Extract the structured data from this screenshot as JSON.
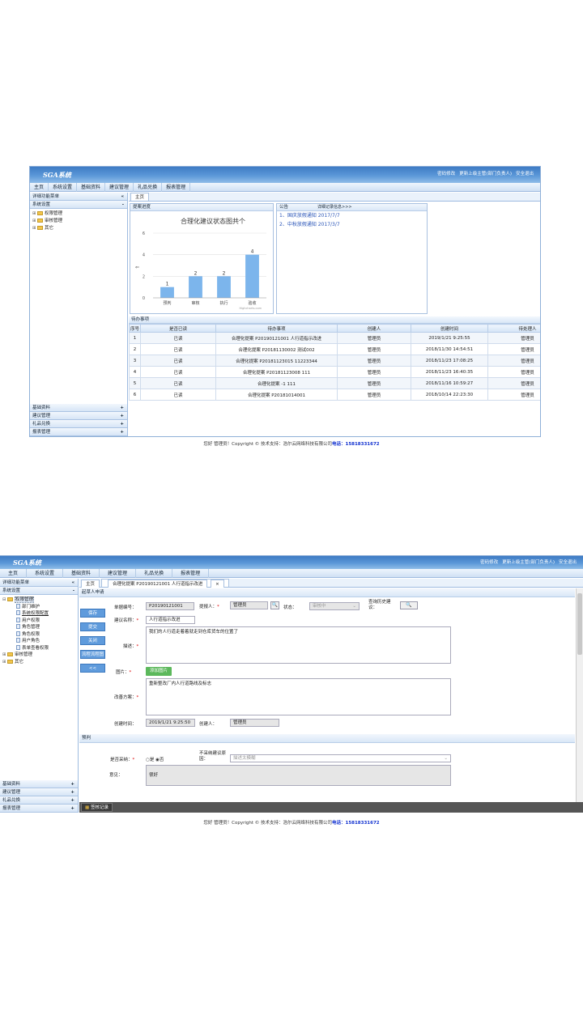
{
  "app": {
    "logo": "SGA系统",
    "top_links": [
      "密码修改",
      "更新上级主管(部门负责人)",
      "安全退出"
    ]
  },
  "menu": [
    "主页",
    "系统设置",
    "基础资料",
    "建议管理",
    "礼品兑换",
    "报表管理"
  ],
  "s1": {
    "sidebar_title": "详细功能菜单",
    "collapse": "«",
    "group": "系统设置",
    "group_toggle": "-",
    "tree": [
      "权限管理",
      "审核管理",
      "其它"
    ],
    "bottom": [
      {
        "label": "基础资料",
        "t": "+"
      },
      {
        "label": "建议管理",
        "t": "+"
      },
      {
        "label": "礼品兑换",
        "t": "+"
      },
      {
        "label": "报表管理",
        "t": "+"
      }
    ],
    "tab": "主页",
    "progress_header": "提案进度",
    "notice_header": "公告",
    "notice_more": "详细记录信息>>>",
    "notices": [
      {
        "n": "1、",
        "t": "国庆放假通知 2017/7/7"
      },
      {
        "n": "2、",
        "t": "中秋放假通知 2017/3/7"
      }
    ],
    "todo_header": "待办事项",
    "todo_cols": [
      "序号",
      "是否已读",
      "待办事项",
      "创建人",
      "创建时间",
      "待处理人"
    ],
    "todo_rows": [
      [
        "1",
        "已读",
        "合理化提案 P20190121001 人行道指示改进",
        "管理员",
        "2019/1/21 9:25:55",
        "管理员"
      ],
      [
        "2",
        "已读",
        "合理化提案 P20181130002 测试002",
        "管理员",
        "2018/11/30 14:54:51",
        "管理员"
      ],
      [
        "3",
        "已读",
        "合理化提案 P20181123015 11223344",
        "管理员",
        "2018/11/23 17:08:25",
        "管理员"
      ],
      [
        "4",
        "已读",
        "合理化提案 P20181123008 111",
        "管理员",
        "2018/11/23 16:40:35",
        "管理员"
      ],
      [
        "5",
        "已读",
        "合理化提案 -1 111",
        "管理员",
        "2018/11/16 10:59:27",
        "管理员"
      ],
      [
        "6",
        "已读",
        "合理化提案 P20181014001",
        "管理员",
        "2018/10/14 22:23:30",
        "管理员"
      ]
    ],
    "footer": "您好 管理员！Copyright © 技术支持：浩尔云网络科技有限公司",
    "footer_phone": "电话：15818331672"
  },
  "chart_data": {
    "type": "bar",
    "title": "合理化建议状态图共个",
    "categories": [
      "预判",
      "审核",
      "执行",
      "验收"
    ],
    "values": [
      1,
      2,
      2,
      4
    ],
    "ylim": [
      0,
      6
    ],
    "yticks": [
      0,
      2,
      4,
      6
    ],
    "color": "#7cb5ec",
    "credit": "Highcharts.com"
  },
  "s2": {
    "sidebar_title": "详细功能菜单",
    "collapse": "«",
    "group": "系统设置",
    "group_toggle": "-",
    "tree": [
      {
        "label": "权限管理",
        "lvl": 0,
        "type": "fold",
        "pm": "⊟",
        "sel": true
      },
      {
        "label": "部门维护",
        "lvl": 1,
        "type": "leaf"
      },
      {
        "label": "系统权限配置",
        "lvl": 1,
        "type": "leaf",
        "u": true
      },
      {
        "label": "用户权限",
        "lvl": 1,
        "type": "leaf"
      },
      {
        "label": "角色管理",
        "lvl": 1,
        "type": "leaf"
      },
      {
        "label": "角色权限",
        "lvl": 1,
        "type": "leaf"
      },
      {
        "label": "用户角色",
        "lvl": 1,
        "type": "leaf"
      },
      {
        "label": "表单查看权限",
        "lvl": 1,
        "type": "leaf"
      },
      {
        "label": "审核管理",
        "lvl": 0,
        "type": "fold",
        "pm": "⊞"
      },
      {
        "label": "其它",
        "lvl": 0,
        "type": "fold",
        "pm": "⊞"
      }
    ],
    "bottom": [
      {
        "label": "基础资料",
        "t": "+"
      },
      {
        "label": "建议管理",
        "t": "+"
      },
      {
        "label": "礼品兑换",
        "t": "+"
      },
      {
        "label": "报表管理",
        "t": "+"
      }
    ],
    "tabs": [
      "主页",
      "合理化提案 P20190121001 人行道指示改进",
      "×"
    ],
    "section1": "起草人申请",
    "buttons": [
      "保存",
      "提交",
      "关闭",
      "流程流程图",
      "<<"
    ],
    "form": {
      "no_label": "单据编号：",
      "no": "P20190121001",
      "submitter_label": "提报人：",
      "submitter": "管理员",
      "status_label": "状态：",
      "status": "审核中",
      "history_label": "查询历史建议：",
      "name_label": "建议名称：",
      "name": "人行道指示改进",
      "desc_label": "描述：",
      "desc": "我们的人行道走着着就走到仓库货车的位置了",
      "img_label": "图片：",
      "img_btn": "添加图片",
      "plan_label": "改善方案：",
      "plan": "重新整改厂内人行道路线及标志",
      "ctime_label": "创建时间：",
      "ctime": "2019/1/21 9:25:50",
      "creator_label": "创建人：",
      "creator": "管理员"
    },
    "section2": "预判",
    "pre": {
      "adopt_label": "是否采纳：",
      "yes": "是",
      "no": "否",
      "reason_label": "不采纳建议原因：",
      "reason_ph": "描述太模糊",
      "opinion_label": "意见：",
      "opinion": "很好"
    },
    "log_btn": "签核记录",
    "footer": "您好 管理员！Copyright © 技术支持：浩尔云网络科技有限公司",
    "footer_phone": "电话：15818331672"
  }
}
